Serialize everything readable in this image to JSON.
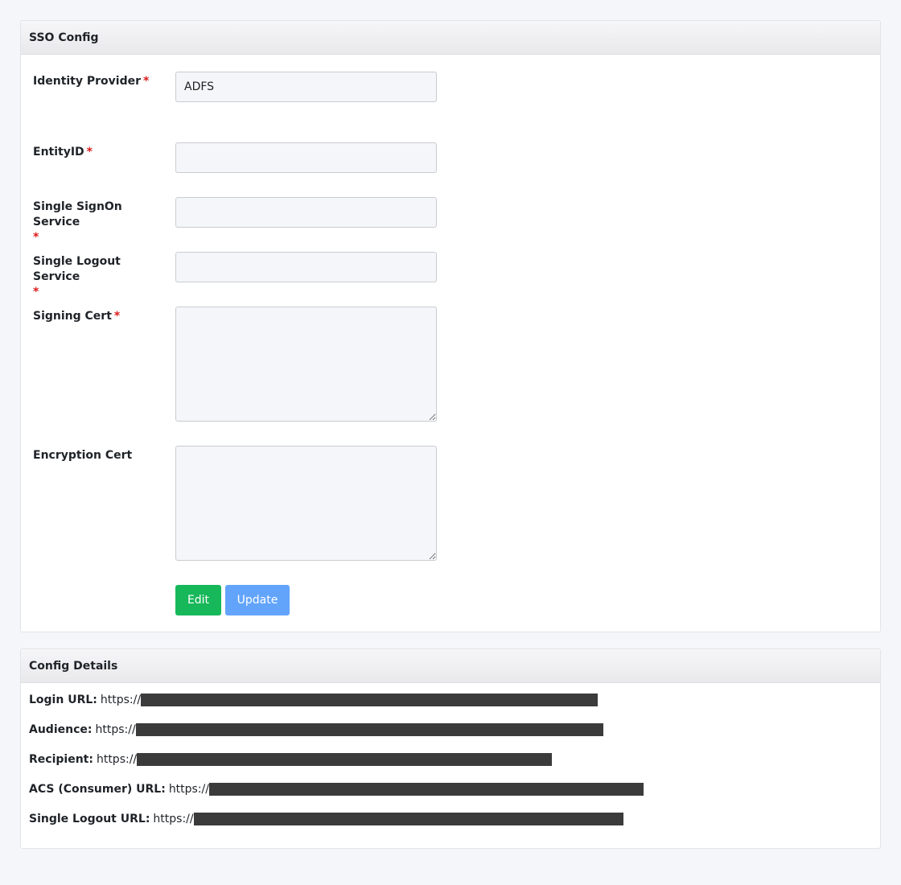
{
  "sso_config": {
    "title": "SSO Config",
    "required_mark": "*",
    "fields": {
      "identity_provider": {
        "label": "Identity Provider",
        "value": "ADFS"
      },
      "entity_id": {
        "label": "EntityID",
        "value": ""
      },
      "single_signon": {
        "label": "Single SignOn Service",
        "value": ""
      },
      "single_logout": {
        "label": "Single Logout Service",
        "value": ""
      },
      "signing_cert": {
        "label": "Signing Cert",
        "value": ""
      },
      "encryption_cert": {
        "label": "Encryption Cert",
        "value": ""
      }
    },
    "buttons": {
      "edit": "Edit",
      "update": "Update"
    }
  },
  "config_details": {
    "title": "Config Details",
    "rows": [
      {
        "label": "Login URL:",
        "value": "https://"
      },
      {
        "label": "Audience:",
        "value": "https://"
      },
      {
        "label": "Recipient:",
        "value": "https://"
      },
      {
        "label": "ACS (Consumer) URL:",
        "value": "https://"
      },
      {
        "label": "Single Logout URL:",
        "value": "https://"
      }
    ]
  },
  "colors": {
    "edit_button": "#17b85a",
    "update_button": "#62a4fb",
    "required": "#dc1a1a",
    "redaction": "#3b3b3b"
  }
}
